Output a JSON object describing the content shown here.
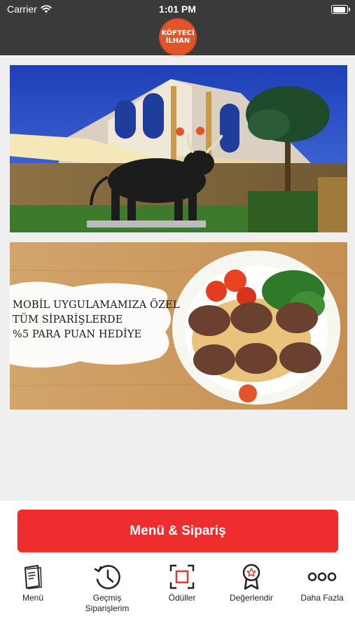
{
  "status": {
    "carrier": "Carrier",
    "time": "1:01 PM"
  },
  "brand": {
    "line1": "KÖFTECİ",
    "line2": "İLHAN",
    "color": "#e2542a"
  },
  "promo": {
    "line1": "MOBİL UYGULAMAMIZA ÖZEL",
    "line2": "TÜM SİPARİŞLERDE",
    "line3": "%5 PARA PUAN HEDİYE"
  },
  "cta": {
    "label": "Menü & Sipariş",
    "color": "#ee2e2e"
  },
  "tabs": [
    {
      "label": "Menü",
      "icon": "menu-book-icon"
    },
    {
      "label": "Geçmiş Siparişlerim",
      "icon": "history-clock-icon"
    },
    {
      "label": "Ödüller",
      "icon": "rewards-icon"
    },
    {
      "label": "Değerlendir",
      "icon": "rating-badge-icon"
    },
    {
      "label": "Daha Fazla",
      "icon": "more-dots-icon"
    }
  ]
}
